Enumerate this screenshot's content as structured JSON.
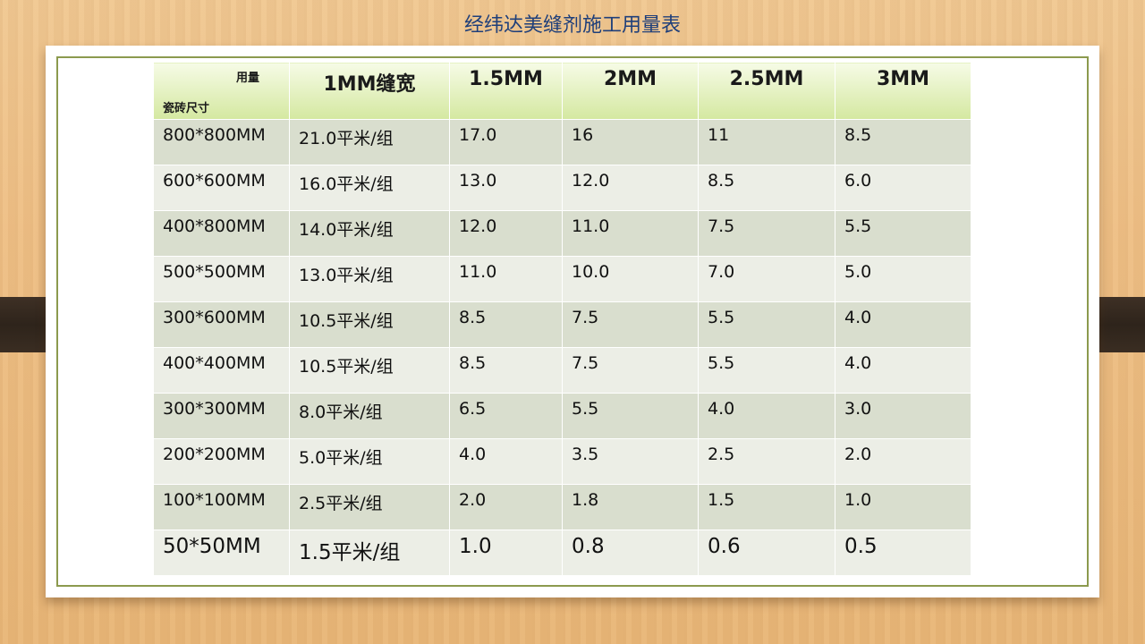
{
  "title": "经纬达美缝剂施工用量表",
  "table": {
    "corner_top": "用量",
    "corner_bottom": "瓷砖尺寸",
    "headers": [
      "1MM缝宽",
      "1.5MM",
      "2MM",
      "2.5MM",
      "3MM"
    ],
    "rows": [
      [
        "800*800MM",
        "21.0平米/组",
        "17.0",
        "16",
        "11",
        "8.5"
      ],
      [
        "600*600MM",
        "16.0平米/组",
        "13.0",
        "12.0",
        "8.5",
        "6.0"
      ],
      [
        "400*800MM",
        "14.0平米/组",
        "12.0",
        "11.0",
        "7.5",
        "5.5"
      ],
      [
        "500*500MM",
        "13.0平米/组",
        "11.0",
        "10.0",
        "7.0",
        "5.0"
      ],
      [
        "300*600MM",
        "10.5平米/组",
        "8.5",
        "7.5",
        "5.5",
        "4.0"
      ],
      [
        "400*400MM",
        "10.5平米/组",
        "8.5",
        "7.5",
        "5.5",
        "4.0"
      ],
      [
        "300*300MM",
        "8.0平米/组",
        "6.5",
        "5.5",
        "4.0",
        "3.0"
      ],
      [
        "200*200MM",
        "5.0平米/组",
        "4.0",
        "3.5",
        "2.5",
        "2.0"
      ],
      [
        "100*100MM",
        "2.5平米/组",
        "2.0",
        "1.8",
        "1.5",
        "1.0"
      ],
      [
        "50*50MM",
        "1.5平米/组",
        "1.0",
        "0.8",
        "0.6",
        "0.5"
      ]
    ]
  },
  "colors": {
    "title": "#1f3f7a",
    "frame": "#8c9a4e",
    "header_top": "#f6fbe6",
    "header_bottom": "#d4e8a0",
    "row_odd": "#d9dece",
    "row_even": "#eceee6"
  }
}
